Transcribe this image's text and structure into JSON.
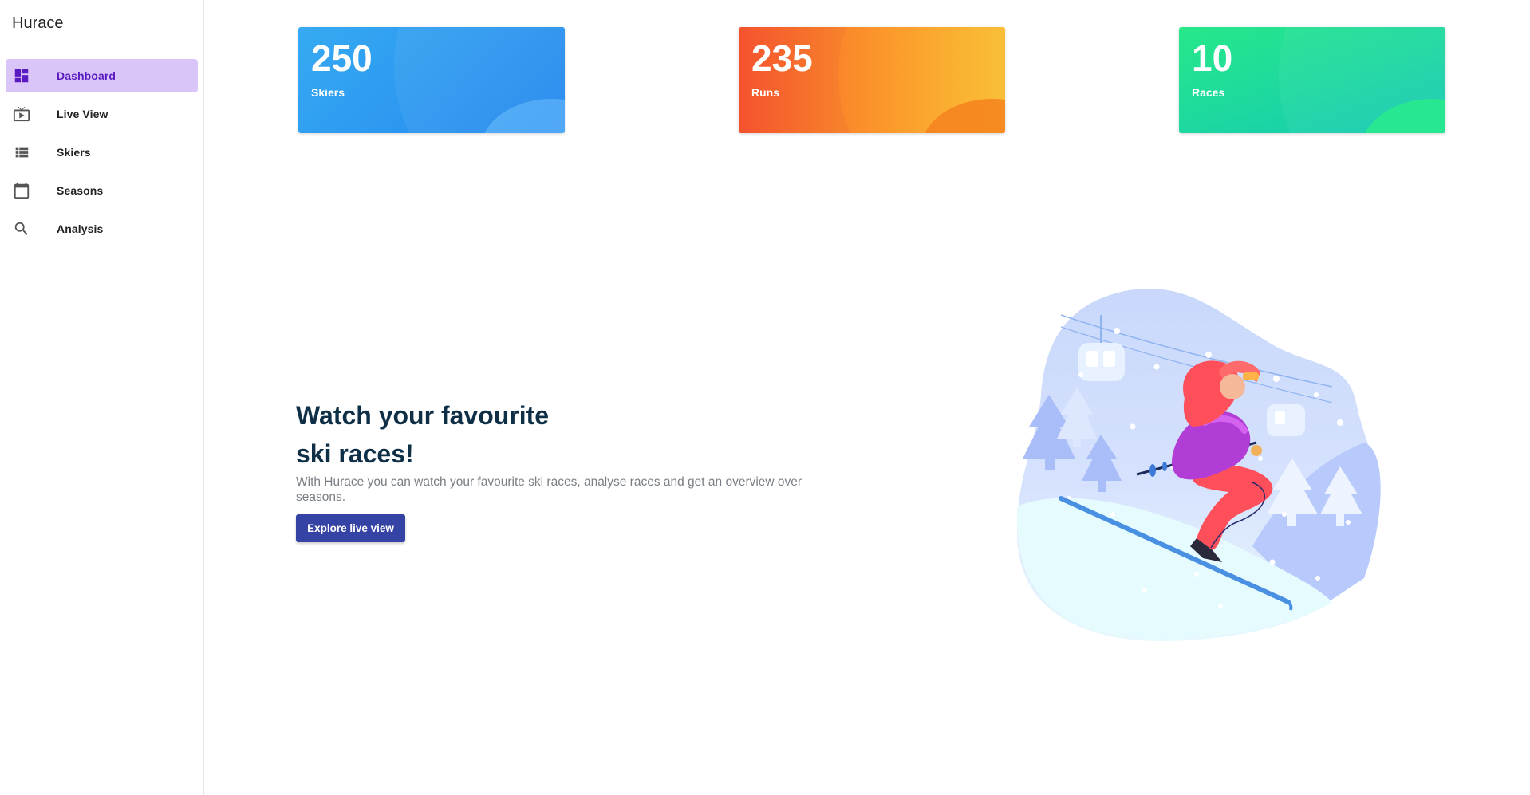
{
  "app": {
    "title": "Hurace"
  },
  "sidebar": {
    "items": [
      {
        "label": "Dashboard",
        "icon": "dashboard-icon",
        "active": true
      },
      {
        "label": "Live View",
        "icon": "live-tv-icon",
        "active": false
      },
      {
        "label": "Skiers",
        "icon": "list-icon",
        "active": false
      },
      {
        "label": "Seasons",
        "icon": "calendar-icon",
        "active": false
      },
      {
        "label": "Analysis",
        "icon": "search-icon",
        "active": false
      }
    ]
  },
  "stats": [
    {
      "value": "250",
      "label": "Skiers",
      "color": "#2a92f0"
    },
    {
      "value": "235",
      "label": "Runs",
      "color": "#f7772c"
    },
    {
      "value": "10",
      "label": "Races",
      "color": "#1fd9a0"
    }
  ],
  "hero": {
    "title_line1": "Watch your favourite",
    "title_line2": "ski races!",
    "description": "With Hurace you can watch your favourite ski races, analyse races and get an overview over seasons.",
    "button_label": "Explore live view"
  },
  "colors": {
    "accent": "#3443a4",
    "nav_active_bg": "#d9c5f7",
    "nav_active_text": "#5a1ac2"
  }
}
